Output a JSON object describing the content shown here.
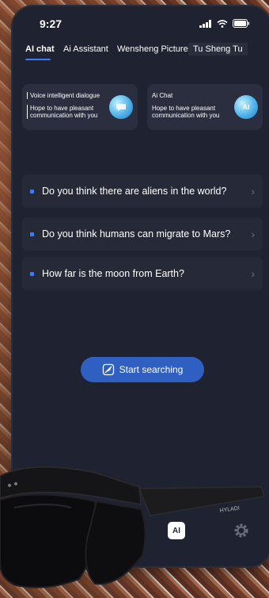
{
  "status": {
    "time": "9:27"
  },
  "tabs": [
    {
      "label": "AI chat",
      "active": true
    },
    {
      "label": "Ai Assistant",
      "active": false
    },
    {
      "label": "Wensheng Picture",
      "active": false
    },
    {
      "label": "Tu Sheng Tu",
      "active": false
    }
  ],
  "cards": [
    {
      "title": "Voice intelligent dialogue",
      "desc": "Hope to have pleasant communication with you",
      "icon": "voice-chat-bubble-icon"
    },
    {
      "title": "Ai Chat",
      "desc": "Hope to have pleasant communication with you",
      "icon_text": "Ai"
    }
  ],
  "questions": [
    {
      "text": "Do you think there are aliens in the world?"
    },
    {
      "text": "Do you think humans can migrate to Mars?"
    },
    {
      "text": "How far is the moon from Earth?"
    }
  ],
  "search_button": {
    "label": "Start searching"
  },
  "bottom_nav": {
    "ai_label": "AI"
  },
  "product": {
    "brand": "HYLADI"
  },
  "colors": {
    "accent": "#3a7bff",
    "button": "#2f5fc1",
    "screen_bg": "#1f2230",
    "card_bg": "#2a2e3e"
  }
}
